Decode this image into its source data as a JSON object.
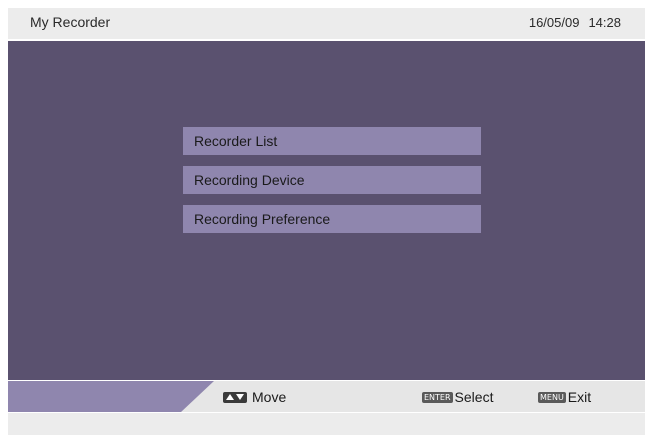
{
  "header": {
    "title": "My Recorder",
    "date": "16/05/09",
    "time": "14:28"
  },
  "menu": {
    "items": [
      {
        "label": "Recorder List"
      },
      {
        "label": "Recording Device"
      },
      {
        "label": "Recording Preference"
      }
    ]
  },
  "footer": {
    "move": {
      "icon": "up-down-arrows-icon",
      "label": "Move"
    },
    "select": {
      "key": "ENTER",
      "label": "Select"
    },
    "exit": {
      "key": "MENU",
      "label": "Exit"
    }
  },
  "colors": {
    "main_background": "#5a516f",
    "menu_item": "#8f86ae",
    "bar": "#ececec"
  }
}
